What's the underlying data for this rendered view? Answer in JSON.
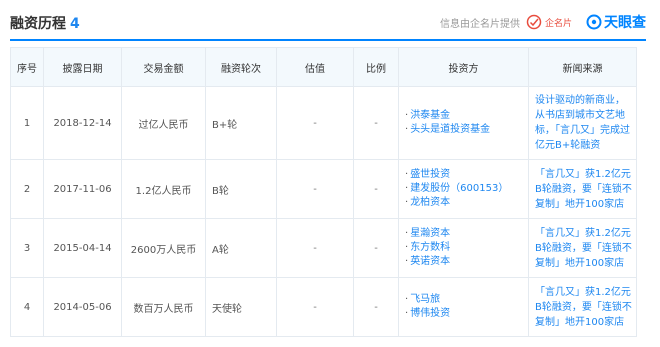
{
  "header": {
    "title": "融资历程",
    "count": "4",
    "source_text": "信息由企名片提供",
    "qmp_logo_text": "企名片",
    "tyc_logo_text": "天眼查"
  },
  "table": {
    "columns": [
      "序号",
      "披露日期",
      "交易金额",
      "融资轮次",
      "估值",
      "比例",
      "投资方",
      "新闻来源"
    ],
    "rows": [
      {
        "index": "1",
        "date": "2018-12-14",
        "amount": "过亿人民币",
        "round": "B+轮",
        "valuation": "-",
        "ratio": "-",
        "investors": [
          "洪泰基金",
          "头头是道投资基金"
        ],
        "news": "设计驱动的新商业，从书店到城市文艺地标，「言几又」完成过亿元B+轮融资"
      },
      {
        "index": "2",
        "date": "2017-11-06",
        "amount": "1.2亿人民币",
        "round": "B轮",
        "valuation": "-",
        "ratio": "-",
        "investors": [
          "盛世投资",
          "建发股份（600153）",
          "龙柏资本"
        ],
        "news": "「言几又」获1.2亿元B轮融资，要「连锁不复制」地开100家店"
      },
      {
        "index": "3",
        "date": "2015-04-14",
        "amount": "2600万人民币",
        "round": "A轮",
        "valuation": "-",
        "ratio": "-",
        "investors": [
          "星瀚资本",
          "东方数科",
          "英诺资本"
        ],
        "news": "「言几又」获1.2亿元B轮融资，要「连锁不复制」地开100家店"
      },
      {
        "index": "4",
        "date": "2014-05-06",
        "amount": "数百万人民币",
        "round": "天使轮",
        "valuation": "-",
        "ratio": "-",
        "investors": [
          "飞马旅",
          "博伟投资"
        ],
        "news": "「言几又」获1.2亿元B轮融资，要「连锁不复制」地开100家店"
      }
    ]
  },
  "colors": {
    "accent": "#0084ff",
    "link": "#1e87f0",
    "qmp_red": "#e84c3d"
  }
}
